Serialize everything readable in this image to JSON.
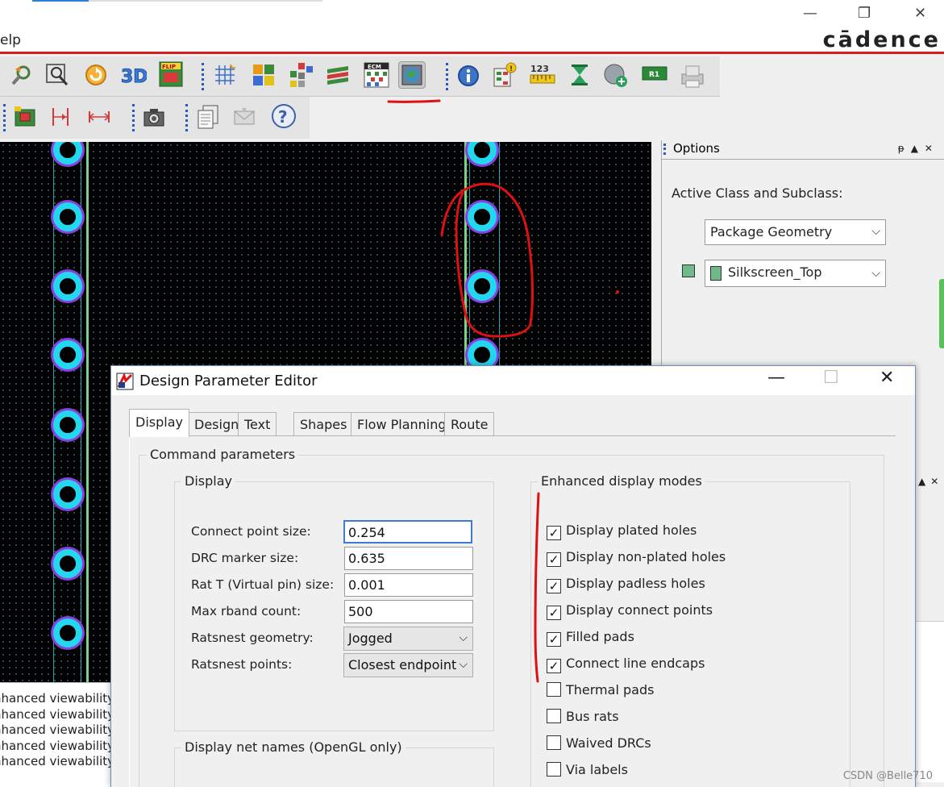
{
  "window": {
    "menu_partial": "elp",
    "logo": "cādence",
    "minimize": "—",
    "restore": "❐",
    "close": "✕"
  },
  "toolbar": {
    "row1_icons": [
      "zoom-back-icon",
      "zoom-fit-icon",
      "refresh-icon",
      "3d-view-icon",
      "flip-board-icon",
      "grid-icon",
      "color-icon",
      "layers-icon",
      "stack-icon",
      "cm-icon",
      "design-parameters-icon",
      "info-icon",
      "report-icon",
      "measure-icon",
      "hourglass-icon",
      "add-circle-icon",
      "r1-icon",
      "printer-icon"
    ],
    "row2_icons": [
      "board-icon",
      "dimension-icon",
      "span-icon",
      "camera-icon",
      "copy-icon",
      "mail-icon",
      "help-icon"
    ],
    "flip_label": "FLIP",
    "cm_label": "ECM",
    "num_label": "123",
    "r1_label": "R1"
  },
  "options_panel": {
    "title": "Options",
    "pin": "ᵽ",
    "active_label": "Active Class and Subclass:",
    "class_value": "Package Geometry",
    "subclass_value": "Silkscreen_Top",
    "subclass_color": "#6fb98a"
  },
  "log": {
    "lines": [
      "nhanced viewability",
      "nhanced viewability",
      "nhanced viewability",
      "nhanced viewability",
      "nhanced viewability"
    ]
  },
  "dialog": {
    "title": "Design Parameter Editor",
    "tabs": [
      "Display",
      "Design",
      "Text",
      "Shapes",
      "Flow Planning",
      "Route"
    ],
    "active_tab": "Display",
    "command_group": "Command parameters",
    "display_group": "Display",
    "fields": [
      {
        "label": "Connect point size:",
        "value": "0.254"
      },
      {
        "label": "DRC marker size:",
        "value": "0.635"
      },
      {
        "label": "Rat T (Virtual pin) size:",
        "value": "0.001"
      },
      {
        "label": "Max rband count:",
        "value": "500"
      }
    ],
    "selects": [
      {
        "label": "Ratsnest geometry:",
        "value": "Jogged"
      },
      {
        "label": "Ratsnest points:",
        "value": "Closest endpoint"
      }
    ],
    "net_names_group": "Display net names (OpenGL only)",
    "enhanced_group": "Enhanced display modes",
    "checkboxes": [
      {
        "label": "Display plated holes",
        "checked": true
      },
      {
        "label": "Display non-plated holes",
        "checked": true
      },
      {
        "label": "Display padless holes",
        "checked": true
      },
      {
        "label": "Display connect points",
        "checked": true
      },
      {
        "label": "Filled pads",
        "checked": true
      },
      {
        "label": "Connect line endcaps",
        "checked": true
      },
      {
        "label": "Thermal pads",
        "checked": false
      },
      {
        "label": "Bus rats",
        "checked": false
      },
      {
        "label": "Waived DRCs",
        "checked": false
      },
      {
        "label": "Via labels",
        "checked": false
      }
    ]
  },
  "watermark": "CSDN @Belle710",
  "colors": {
    "accent_red": "#d21e1e",
    "pad_ring": "#23d7ee",
    "pad_glow": "#8a3fe0",
    "trace_green": "#7fd18a",
    "annotation": "#e01010"
  }
}
